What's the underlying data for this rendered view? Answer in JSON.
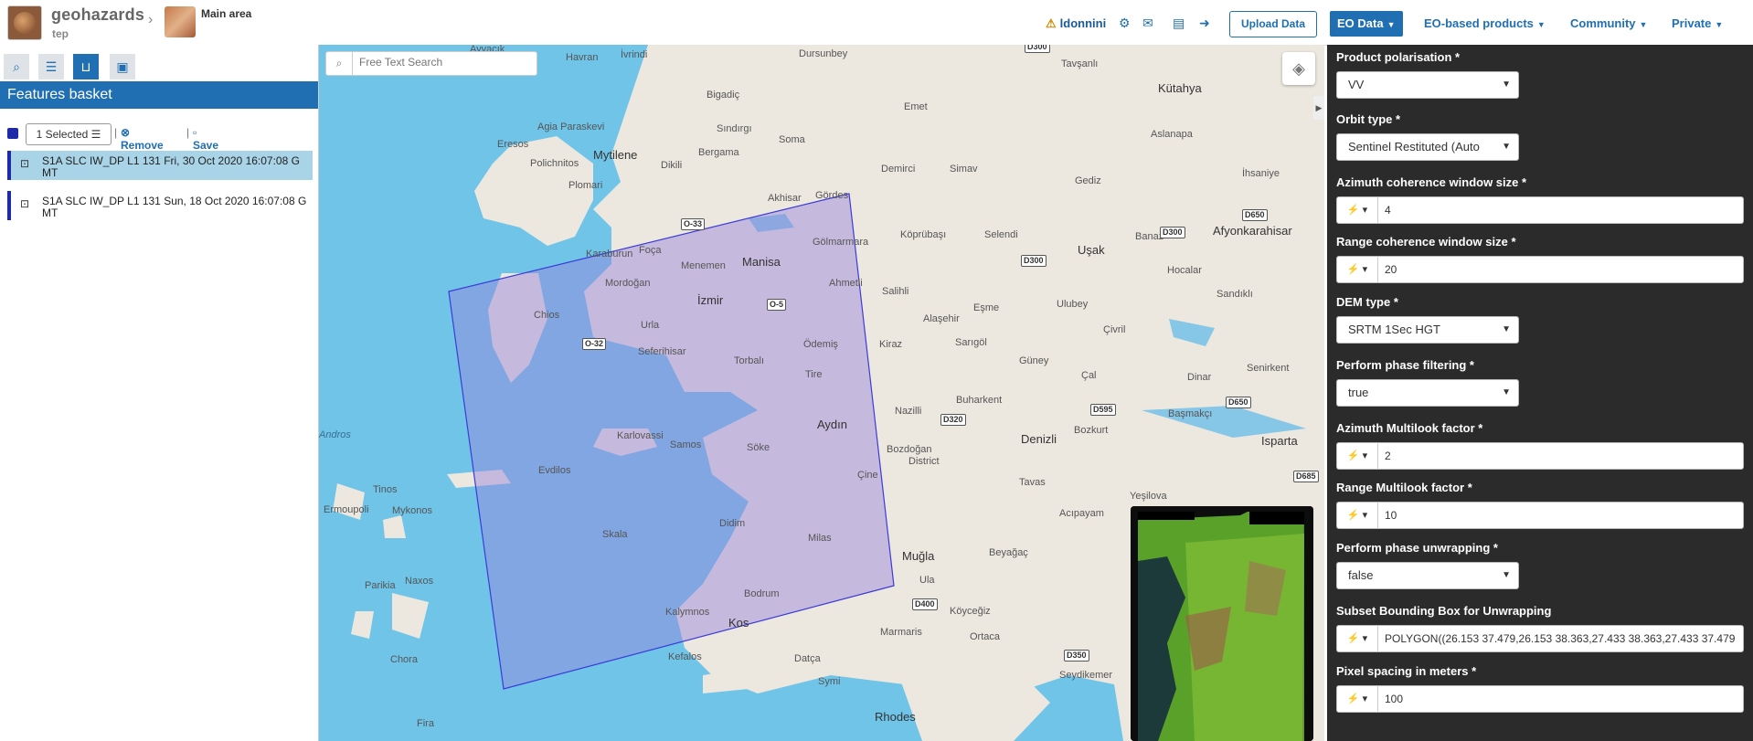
{
  "header": {
    "brand": "geohazards",
    "brand_sub": "tep",
    "area_label": "Main area",
    "user": "ldonnini",
    "upload_label": "Upload Data",
    "nav": [
      {
        "label": "EO Data"
      },
      {
        "label": "EO-based products"
      },
      {
        "label": "Community"
      },
      {
        "label": "Private"
      }
    ]
  },
  "left": {
    "title": "Features basket",
    "selected_label": "1 Selected",
    "remove_all": "Remove all",
    "save": "Save",
    "items": [
      {
        "title": "S1A SLC IW_DP L1 131 Fri, 30 Oct 2020 16:07:08 G",
        "tail": "MT"
      },
      {
        "title": "S1A SLC IW_DP L1 131 Sun, 18 Oct 2020 16:07:08 G",
        "tail": "MT"
      }
    ]
  },
  "map": {
    "search_placeholder": "Free Text Search",
    "labels": {
      "ayvacik": "Ayvacık",
      "havran": "Havran",
      "ivrindi": "İvrindi",
      "dursunbey": "Dursunbey",
      "tavsanli": "Tavşanlı",
      "kutahya": "Kütahya",
      "bigadic": "Bigadiç",
      "emet": "Emet",
      "agia_paraskevi": "Agia Paraskevi",
      "sindirgi": "Sındırgı",
      "aslanapa": "Aslanapa",
      "eresos": "Eresos",
      "mytilene": "Mytilene",
      "bergama": "Bergama",
      "soma": "Soma",
      "demirci": "Demirci",
      "simav": "Simav",
      "ihsaniye": "İhsaniye",
      "polichnitos": "Polichnitos",
      "dikili": "Dikili",
      "gediz": "Gediz",
      "plomari": "Plomari",
      "akhisar": "Akhisar",
      "gordes": "Gördes",
      "afyonkarahisar": "Afyonkarahisar",
      "karaburun": "Karaburun",
      "foca": "Foça",
      "golmarmara": "Gölmarmara",
      "koprubasi": "Köprübaşı",
      "selendi": "Selendi",
      "usak": "Uşak",
      "banaz": "Banaz",
      "hocalar": "Hocalar",
      "menemen": "Menemen",
      "manisa": "Manisa",
      "mordogan": "Mordoğan",
      "ahmetli": "Ahmetli",
      "salihli": "Salihli",
      "sandikli": "Sandıklı",
      "chios": "Chios",
      "izmir": "İzmir",
      "esme": "Eşme",
      "ulubey": "Ulubey",
      "urla": "Urla",
      "alasehir": "Alaşehir",
      "civril": "Çivril",
      "seferihisar": "Seferihisar",
      "odemis": "Ödemiş",
      "kiraz": "Kiraz",
      "sarigol": "Sarıgöl",
      "torbali": "Torbalı",
      "guney": "Güney",
      "senirkent": "Senirkent",
      "tire": "Tire",
      "cal": "Çal",
      "dinar": "Dinar",
      "buharkent": "Buharkent",
      "nazilli": "Nazilli",
      "basmakci": "Başmakçı",
      "aydin": "Aydın",
      "bozkurt": "Bozkurt",
      "andros": "Andros",
      "karlovassi": "Karlovassi",
      "samos": "Samos",
      "denizli": "Denizli",
      "isparta": "Isparta",
      "soke": "Söke",
      "bozdogan": "Bozdoğan",
      "district": "District",
      "evdilos": "Evdilos",
      "cine": "Çine",
      "tavas": "Tavas",
      "tinos": "Tinos",
      "yesilova": "Yeşilova",
      "ermoupoli": "Ermoupoli",
      "mykonos": "Mykonos",
      "acipayam": "Acıpayam",
      "didim": "Didim",
      "skala": "Skala",
      "milas": "Milas",
      "mugla": "Muğla",
      "beyagac": "Beyağaç",
      "parikia": "Parikia",
      "naxos": "Naxos",
      "ula": "Ula",
      "bodrum": "Bodrum",
      "koycegiz": "Köyceğiz",
      "kalymnos": "Kalymnos",
      "kos": "Kos",
      "marmaris": "Marmaris",
      "ortaca": "Ortaca",
      "chora": "Chora",
      "kefalos": "Kefalos",
      "datca": "Datça",
      "symi": "Symi",
      "seydikemer": "Seydikemer",
      "rhodes": "Rhodes",
      "fira": "Fira"
    },
    "shields": {
      "o33": "O-33",
      "o5": "O-5",
      "o32": "O-32",
      "d300a": "D300",
      "d300b": "D300",
      "d300c": "D300",
      "d650a": "D650",
      "d650b": "D650",
      "d595": "D595",
      "d320": "D320",
      "d685": "D685",
      "d400": "D400",
      "d350": "D350"
    }
  },
  "params": {
    "polarisation": {
      "label": "Product polarisation *",
      "value": "VV"
    },
    "orbit": {
      "label": "Orbit type *",
      "value": "Sentinel Restituted (Auto"
    },
    "az_coh": {
      "label": "Azimuth coherence window size *",
      "value": "4"
    },
    "rg_coh": {
      "label": "Range coherence window size *",
      "value": "20"
    },
    "dem": {
      "label": "DEM type *",
      "value": "SRTM 1Sec HGT"
    },
    "phase_filter": {
      "label": "Perform phase filtering *",
      "value": "true"
    },
    "az_ml": {
      "label": "Azimuth Multilook factor *",
      "value": "2"
    },
    "rg_ml": {
      "label": "Range Multilook factor *",
      "value": "10"
    },
    "unwrap": {
      "label": "Perform phase unwrapping *",
      "value": "false"
    },
    "bbox": {
      "label": "Subset Bounding Box for Unwrapping",
      "value": "POLYGON((26.153 37.479,26.153 38.363,27.433 38.363,27.433 37.479"
    },
    "pixel": {
      "label": "Pixel spacing in meters *",
      "value": "100"
    }
  }
}
